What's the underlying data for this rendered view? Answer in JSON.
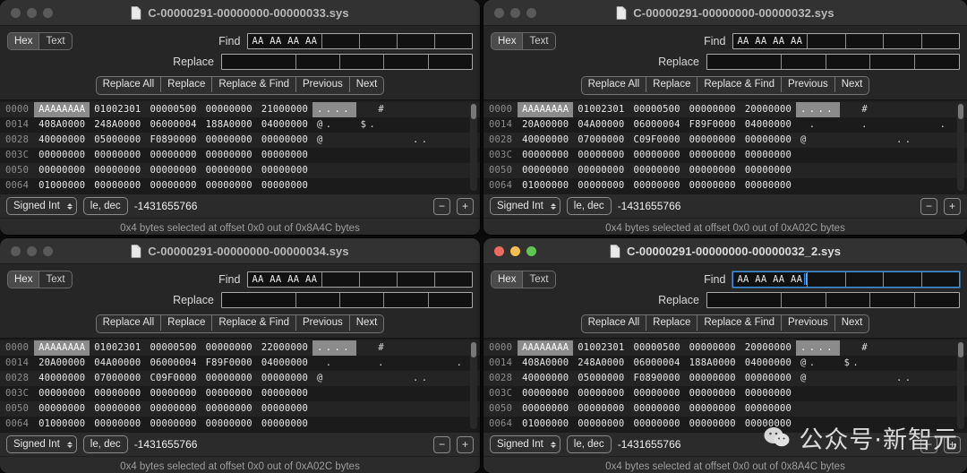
{
  "app": {
    "segmented": {
      "options": [
        "Hex",
        "Text"
      ],
      "selected": "Hex"
    },
    "labels": {
      "find": "Find",
      "replace": "Replace"
    },
    "buttons": [
      "Replace All",
      "Replace",
      "Replace & Find",
      "Previous",
      "Next"
    ],
    "inspector": {
      "type_selected": "Signed Int",
      "endian_selected": "le, dec",
      "value": "-1431655766",
      "minus": "−",
      "plus": "+"
    },
    "find_value": "AA AA AA AA",
    "replace_value": "",
    "colors": {
      "traffic_close": "#ed6a5e",
      "traffic_min": "#f5bf4f",
      "traffic_max": "#61c554",
      "traffic_inactive": "#5a5a5a",
      "focus_ring": "#3f94e8",
      "selection": "#8b8b8b"
    }
  },
  "windows": [
    {
      "id": "win-33",
      "title": "C-00000291-00000000-00000033.sys",
      "active": false,
      "status": "0x4 bytes selected at offset 0x0 out of 0x8A4C bytes",
      "rows": [
        {
          "offset": "0000",
          "groups": [
            "AAAAAAAA",
            "01002301",
            "00000500",
            "00000000",
            "21000000"
          ],
          "ascii_sel": "....",
          "ascii": "  #                    !"
        },
        {
          "offset": "0014",
          "groups": [
            "408A0000",
            "248A0000",
            "06000004",
            "188A0000",
            "04000000"
          ],
          "ascii_sel": "",
          "ascii": "@.   $.            ."
        },
        {
          "offset": "0028",
          "groups": [
            "40000000",
            "05000000",
            "F0890000",
            "00000000",
            "00000000"
          ],
          "ascii_sel": "",
          "ascii": "@          .."
        },
        {
          "offset": "003C",
          "groups": [
            "00000000",
            "00000000",
            "00000000",
            "00000000",
            "00000000"
          ],
          "ascii_sel": "",
          "ascii": ""
        },
        {
          "offset": "0050",
          "groups": [
            "00000000",
            "00000000",
            "00000000",
            "00000000",
            "00000000"
          ],
          "ascii_sel": "",
          "ascii": ""
        },
        {
          "offset": "0064",
          "groups": [
            "01000000",
            "00000000",
            "00000000",
            "00000000",
            "00000000"
          ],
          "ascii_sel": "",
          "ascii": ""
        }
      ]
    },
    {
      "id": "win-32",
      "title": "C-00000291-00000000-00000032.sys",
      "active": false,
      "status": "0x4 bytes selected at offset 0x0 out of 0xA02C bytes",
      "rows": [
        {
          "offset": "0000",
          "groups": [
            "AAAAAAAA",
            "01002301",
            "00000500",
            "00000000",
            "20000000"
          ],
          "ascii_sel": "....",
          "ascii": "  #"
        },
        {
          "offset": "0014",
          "groups": [
            "20A00000",
            "04A00000",
            "06000004",
            "F89F0000",
            "04000000"
          ],
          "ascii_sel": "",
          "ascii": " .     .        . ."
        },
        {
          "offset": "0028",
          "groups": [
            "40000000",
            "07000000",
            "C09F0000",
            "00000000",
            "00000000"
          ],
          "ascii_sel": "",
          "ascii": "@          .."
        },
        {
          "offset": "003C",
          "groups": [
            "00000000",
            "00000000",
            "00000000",
            "00000000",
            "00000000"
          ],
          "ascii_sel": "",
          "ascii": ""
        },
        {
          "offset": "0050",
          "groups": [
            "00000000",
            "00000000",
            "00000000",
            "00000000",
            "00000000"
          ],
          "ascii_sel": "",
          "ascii": ""
        },
        {
          "offset": "0064",
          "groups": [
            "01000000",
            "00000000",
            "00000000",
            "00000000",
            "00000000"
          ],
          "ascii_sel": "",
          "ascii": ""
        }
      ]
    },
    {
      "id": "win-34",
      "title": "C-00000291-00000000-00000034.sys",
      "active": false,
      "status": "0x4 bytes selected at offset 0x0 out of 0xA02C bytes",
      "rows": [
        {
          "offset": "0000",
          "groups": [
            "AAAAAAAA",
            "01002301",
            "00000500",
            "00000000",
            "22000000"
          ],
          "ascii_sel": "....",
          "ascii": "  #                    \""
        },
        {
          "offset": "0014",
          "groups": [
            "20A00000",
            "04A00000",
            "06000004",
            "F89F0000",
            "04000000"
          ],
          "ascii_sel": "",
          "ascii": " .     .        . ."
        },
        {
          "offset": "0028",
          "groups": [
            "40000000",
            "07000000",
            "C09F0000",
            "00000000",
            "00000000"
          ],
          "ascii_sel": "",
          "ascii": "@          .."
        },
        {
          "offset": "003C",
          "groups": [
            "00000000",
            "00000000",
            "00000000",
            "00000000",
            "00000000"
          ],
          "ascii_sel": "",
          "ascii": ""
        },
        {
          "offset": "0050",
          "groups": [
            "00000000",
            "00000000",
            "00000000",
            "00000000",
            "00000000"
          ],
          "ascii_sel": "",
          "ascii": ""
        },
        {
          "offset": "0064",
          "groups": [
            "01000000",
            "00000000",
            "00000000",
            "00000000",
            "00000000"
          ],
          "ascii_sel": "",
          "ascii": ""
        }
      ]
    },
    {
      "id": "win-32-2",
      "title": "C-00000291-00000000-00000032_2.sys",
      "active": true,
      "status": "0x4 bytes selected at offset 0x0 out of 0x8A4C bytes",
      "rows": [
        {
          "offset": "0000",
          "groups": [
            "AAAAAAAA",
            "01002301",
            "00000500",
            "00000000",
            "20000000"
          ],
          "ascii_sel": "....",
          "ascii": "  #"
        },
        {
          "offset": "0014",
          "groups": [
            "408A0000",
            "248A0000",
            "06000004",
            "188A0000",
            "04000000"
          ],
          "ascii_sel": "",
          "ascii": "@.   $.            ."
        },
        {
          "offset": "0028",
          "groups": [
            "40000000",
            "05000000",
            "F0890000",
            "00000000",
            "00000000"
          ],
          "ascii_sel": "",
          "ascii": "@          .."
        },
        {
          "offset": "003C",
          "groups": [
            "00000000",
            "00000000",
            "00000000",
            "00000000",
            "00000000"
          ],
          "ascii_sel": "",
          "ascii": ""
        },
        {
          "offset": "0050",
          "groups": [
            "00000000",
            "00000000",
            "00000000",
            "00000000",
            "00000000"
          ],
          "ascii_sel": "",
          "ascii": ""
        },
        {
          "offset": "0064",
          "groups": [
            "01000000",
            "00000000",
            "00000000",
            "00000000",
            "00000000"
          ],
          "ascii_sel": "",
          "ascii": ""
        }
      ]
    }
  ],
  "watermark": {
    "text": "公众号·新智元"
  }
}
